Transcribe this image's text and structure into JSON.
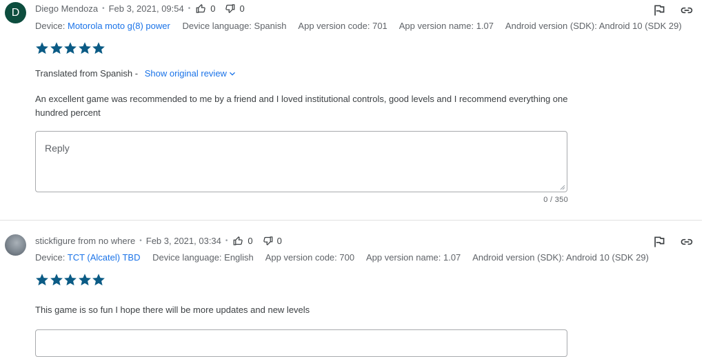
{
  "reviews": [
    {
      "avatar_letter": "D",
      "author": "Diego Mendoza",
      "date": "Feb 3, 2021, 09:54",
      "thumbs_up": "0",
      "thumbs_down": "0",
      "device_label": "Device:",
      "device": "Motorola moto g(8) power",
      "device_language": "Device language: Spanish",
      "app_version_code": "App version code: 701",
      "app_version_name": "App version name: 1.07",
      "android_version": "Android version (SDK): Android 10 (SDK 29)",
      "rating": 5,
      "translated_from": "Translated from Spanish -",
      "show_original": "Show original review",
      "text": "An excellent game was recommended to me by a friend and I loved institutional controls, good levels and I recommend everything one hundred percent",
      "reply_placeholder": "Reply",
      "counter": "0 / 350"
    },
    {
      "author": "stickfigure from no where",
      "date": "Feb 3, 2021, 03:34",
      "thumbs_up": "0",
      "thumbs_down": "0",
      "device_label": "Device:",
      "device": "TCT (Alcatel) TBD",
      "device_language": "Device language: English",
      "app_version_code": "App version code: 700",
      "app_version_name": "App version name: 1.07",
      "android_version": "Android version (SDK): Android 10 (SDK 29)",
      "rating": 5,
      "text": "This game is so fun I hope there will be more updates and new levels"
    }
  ],
  "colors": {
    "star": "#0b5b85",
    "link": "#1a73e8",
    "avatar": "#0d4d3e"
  },
  "icons": [
    "thumb-up-icon",
    "thumb-down-icon",
    "flag-icon",
    "link-icon",
    "star-icon",
    "chevron-down-icon"
  ]
}
